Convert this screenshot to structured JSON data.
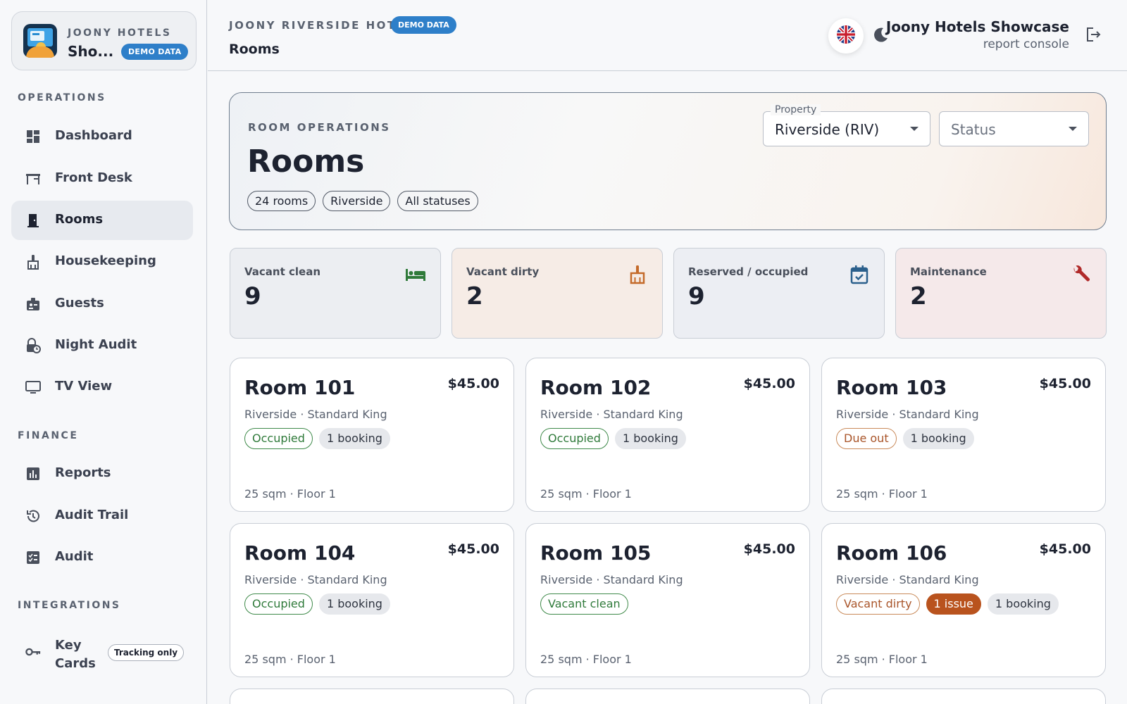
{
  "brand": {
    "subtitle": "JOONY HOTELS",
    "name": "Sho...",
    "badge": "DEMO DATA"
  },
  "nav": {
    "sections": [
      {
        "label": "OPERATIONS"
      },
      {
        "label": "FINANCE"
      },
      {
        "label": "INTEGRATIONS"
      }
    ],
    "items": [
      {
        "label": "Dashboard",
        "icon": "dashboard-icon"
      },
      {
        "label": "Front Desk",
        "icon": "front-desk-icon"
      },
      {
        "label": "Rooms",
        "icon": "door-icon",
        "active": true
      },
      {
        "label": "Housekeeping",
        "icon": "broom-icon"
      },
      {
        "label": "Guests",
        "icon": "badge-icon"
      },
      {
        "label": "Night Audit",
        "icon": "lock-clock-icon"
      },
      {
        "label": "TV View",
        "icon": "monitor-icon"
      },
      {
        "label": "Reports",
        "icon": "bar-chart-icon"
      },
      {
        "label": "Audit Trail",
        "icon": "history-icon"
      },
      {
        "label": "Audit",
        "icon": "checklist-icon"
      },
      {
        "label": "Key\nCards",
        "icon": "key-icon",
        "chip": "Tracking only"
      }
    ]
  },
  "header": {
    "hotel": "JOONY RIVERSIDE HOTEL",
    "badge": "DEMO DATA",
    "page": "Rooms",
    "user_name": "Joony Hotels Showcase",
    "user_role": "report console",
    "language_icon": "uk-flag-icon",
    "theme_icon": "moon-icon",
    "logout_icon": "logout-icon"
  },
  "hero": {
    "subtitle": "ROOM OPERATIONS",
    "title": "Rooms",
    "chips": [
      "24 rooms",
      "Riverside",
      "All statuses"
    ],
    "property": {
      "legend": "Property",
      "value": "Riverside (RIV)"
    },
    "status": {
      "placeholder": "Status"
    }
  },
  "stats": [
    {
      "label": "Vacant clean",
      "value": "9",
      "icon": "bed-icon",
      "color": "#2f7a3a",
      "bg": "#eceef2"
    },
    {
      "label": "Vacant dirty",
      "value": "2",
      "icon": "broom-icon",
      "color": "#c46a2a",
      "bg": "#f6ece6"
    },
    {
      "label": "Reserved / occupied",
      "value": "9",
      "icon": "calendar-check-icon",
      "color": "#2a5f8c",
      "bg": "#eceef3"
    },
    {
      "label": "Maintenance",
      "value": "2",
      "icon": "wrench-icon",
      "color": "#b02a2a",
      "bg": "#f5e9ea"
    }
  ],
  "rooms": [
    {
      "name": "Room 101",
      "price": "$45.00",
      "meta": "Riverside · Standard King",
      "tags": [
        {
          "text": "Occupied",
          "kind": "ok"
        },
        {
          "text": "1 booking",
          "kind": "grey"
        }
      ],
      "foot": "25 sqm · Floor 1"
    },
    {
      "name": "Room 102",
      "price": "$45.00",
      "meta": "Riverside · Standard King",
      "tags": [
        {
          "text": "Occupied",
          "kind": "ok"
        },
        {
          "text": "1 booking",
          "kind": "grey"
        }
      ],
      "foot": "25 sqm · Floor 1"
    },
    {
      "name": "Room 103",
      "price": "$45.00",
      "meta": "Riverside · Standard King",
      "tags": [
        {
          "text": "Due out",
          "kind": "warn"
        },
        {
          "text": "1 booking",
          "kind": "grey"
        }
      ],
      "foot": "25 sqm · Floor 1"
    },
    {
      "name": "Room 104",
      "price": "$45.00",
      "meta": "Riverside · Standard King",
      "tags": [
        {
          "text": "Occupied",
          "kind": "ok"
        },
        {
          "text": "1 booking",
          "kind": "grey"
        }
      ],
      "foot": "25 sqm · Floor 1"
    },
    {
      "name": "Room 105",
      "price": "$45.00",
      "meta": "Riverside · Standard King",
      "tags": [
        {
          "text": "Vacant clean",
          "kind": "ok"
        }
      ],
      "foot": "25 sqm · Floor 1"
    },
    {
      "name": "Room 106",
      "price": "$45.00",
      "meta": "Riverside · Standard King",
      "tags": [
        {
          "text": "Vacant dirty",
          "kind": "warn"
        },
        {
          "text": "1 issue",
          "kind": "issue"
        },
        {
          "text": "1 booking",
          "kind": "grey"
        }
      ],
      "foot": "25 sqm · Floor 1"
    }
  ]
}
